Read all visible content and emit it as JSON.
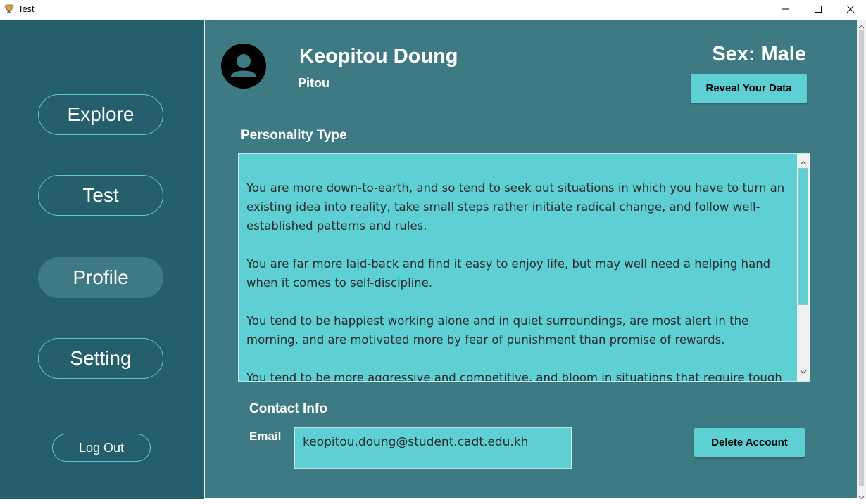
{
  "window": {
    "title": "Test",
    "app_icon": "trophy-icon",
    "controls": [
      "minimize-icon",
      "maximize-icon",
      "close-icon"
    ]
  },
  "sidebar": {
    "items": [
      {
        "label": "Explore",
        "active": false
      },
      {
        "label": "Test",
        "active": false
      },
      {
        "label": "Profile",
        "active": true
      },
      {
        "label": "Setting",
        "active": false
      }
    ],
    "logout_label": "Log Out"
  },
  "profile": {
    "avatar_icon": "user-avatar-icon",
    "full_name": "Keopitou Doung",
    "nickname": "Pitou",
    "sex_label": "Sex:",
    "sex_value": "Male",
    "reveal_button": "Reveal Your Data"
  },
  "personality": {
    "heading": "Personality Type",
    "paragraphs": [
      "You are more down-to-earth, and so tend to seek out situations in which you have to turn an existing idea into reality, take small steps rather  initiate radical change, and follow well-established patterns and rules.",
      "You are far more laid-back and find it easy to enjoy life, but may well need a helping hand when it comes to self-discipline.",
      "You tend to be happiest working alone and in quiet surroundings, are most alert in the morning, and are motivated more by fear of punishment than promise of rewards.",
      "You tend to be more aggressive and competitive, and bloom in situations that require tough"
    ]
  },
  "contact": {
    "heading": "Contact Info",
    "email_label": "Email",
    "email_value": "keopitou.doung@student.cadt.edu.kh",
    "delete_button": "Delete Account"
  },
  "colors": {
    "sidebar_bg": "#245f6b",
    "main_bg": "#3e7a83",
    "accent": "#5ecfd2",
    "active_nav": "#3e7a83"
  }
}
